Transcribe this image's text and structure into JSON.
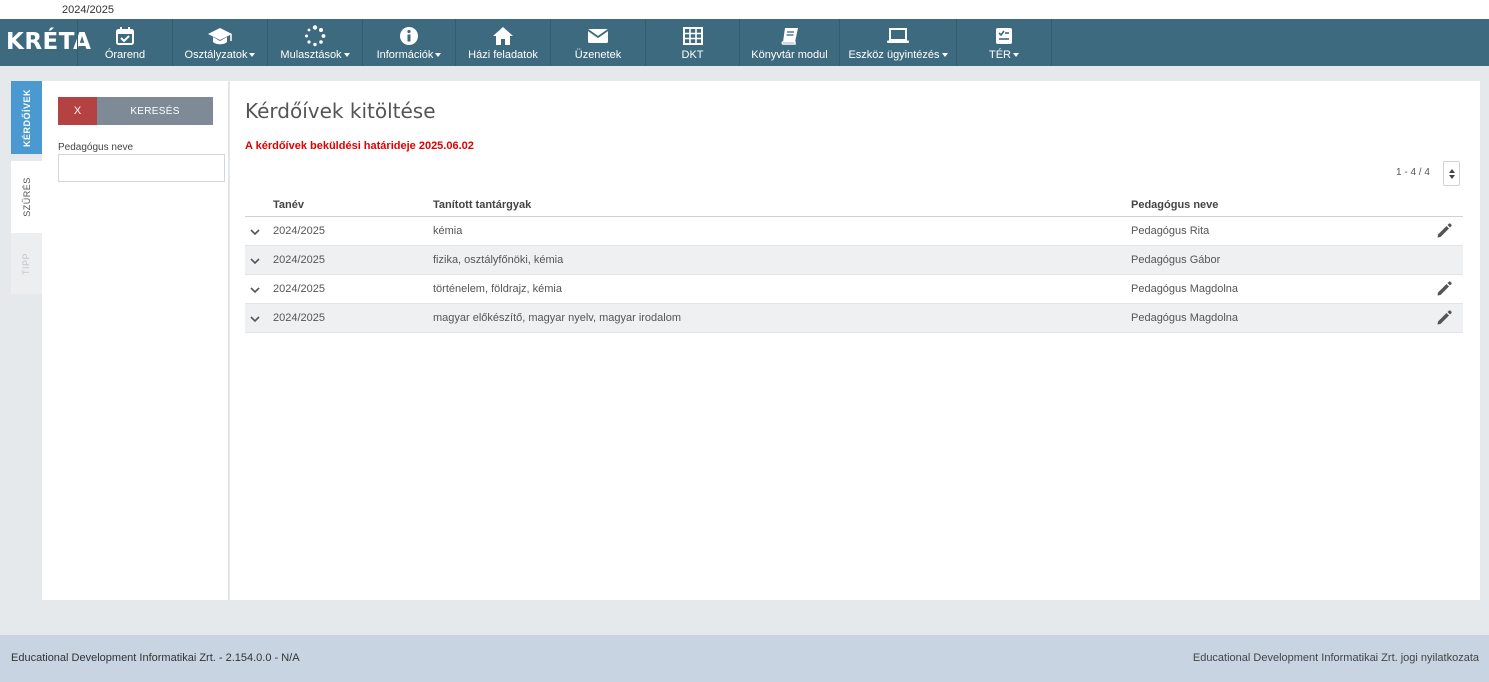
{
  "top_bar": {
    "school_year": "2024/2025"
  },
  "brand": {
    "logo_text": "KRÉTA"
  },
  "nav": [
    {
      "label": "Órarend",
      "icon": "calendar-check-icon",
      "dropdown": false
    },
    {
      "label": "Osztályzatok",
      "icon": "graduation-cap-icon",
      "dropdown": true
    },
    {
      "label": "Mulasztások",
      "icon": "spinner-icon",
      "dropdown": true
    },
    {
      "label": "Információk",
      "icon": "info-circle-icon",
      "dropdown": true
    },
    {
      "label": "Házi feladatok",
      "icon": "home-icon",
      "dropdown": false
    },
    {
      "label": "Üzenetek",
      "icon": "envelope-icon",
      "dropdown": false
    },
    {
      "label": "DKT",
      "icon": "table-grid-icon",
      "dropdown": false
    },
    {
      "label": "Könyvtár modul",
      "icon": "book-icon",
      "dropdown": false
    },
    {
      "label": "Eszköz ügyintézés",
      "icon": "laptop-icon",
      "dropdown": true
    },
    {
      "label": "TÉR",
      "icon": "checklist-icon",
      "dropdown": true
    }
  ],
  "side_tabs": [
    {
      "label": "KÉRDŐÍVEK",
      "state": "active"
    },
    {
      "label": "SZŰRÉS",
      "state": "normal"
    },
    {
      "label": "TIPP",
      "state": "disabled"
    }
  ],
  "filter": {
    "clear_label": "X",
    "search_label": "KERESÉS",
    "teacher_label": "Pedagógus neve",
    "teacher_value": ""
  },
  "main": {
    "title": "Kérdőívek kitöltése",
    "deadline_notice": "A kérdőívek beküldési határideje 2025.06.02",
    "pager_text": "1 - 4 / 4",
    "columns": {
      "year": "Tanév",
      "subjects": "Tanított tantárgyak",
      "teacher": "Pedagógus neve"
    },
    "rows": [
      {
        "year": "2024/2025",
        "subjects": "kémia",
        "teacher": "Pedagógus Rita",
        "editable": true
      },
      {
        "year": "2024/2025",
        "subjects": "fizika, osztályfőnöki, kémia",
        "teacher": "Pedagógus Gábor",
        "editable": false
      },
      {
        "year": "2024/2025",
        "subjects": "történelem, földrajz, kémia",
        "teacher": "Pedagógus Magdolna",
        "editable": true
      },
      {
        "year": "2024/2025",
        "subjects": "magyar előkészítő, magyar nyelv, magyar irodalom",
        "teacher": "Pedagógus Magdolna",
        "editable": true
      }
    ]
  },
  "footer": {
    "left": "Educational Development Informatikai Zrt. - 2.154.0.0 - N/A",
    "right": "Educational Development Informatikai Zrt. jogi nyilatkozata"
  },
  "colors": {
    "navbar": "#3e6a80",
    "accent_blue": "#4a9ad1",
    "danger": "#b44242",
    "deadline_red": "#e00000",
    "footer": "#c8d4e2"
  }
}
